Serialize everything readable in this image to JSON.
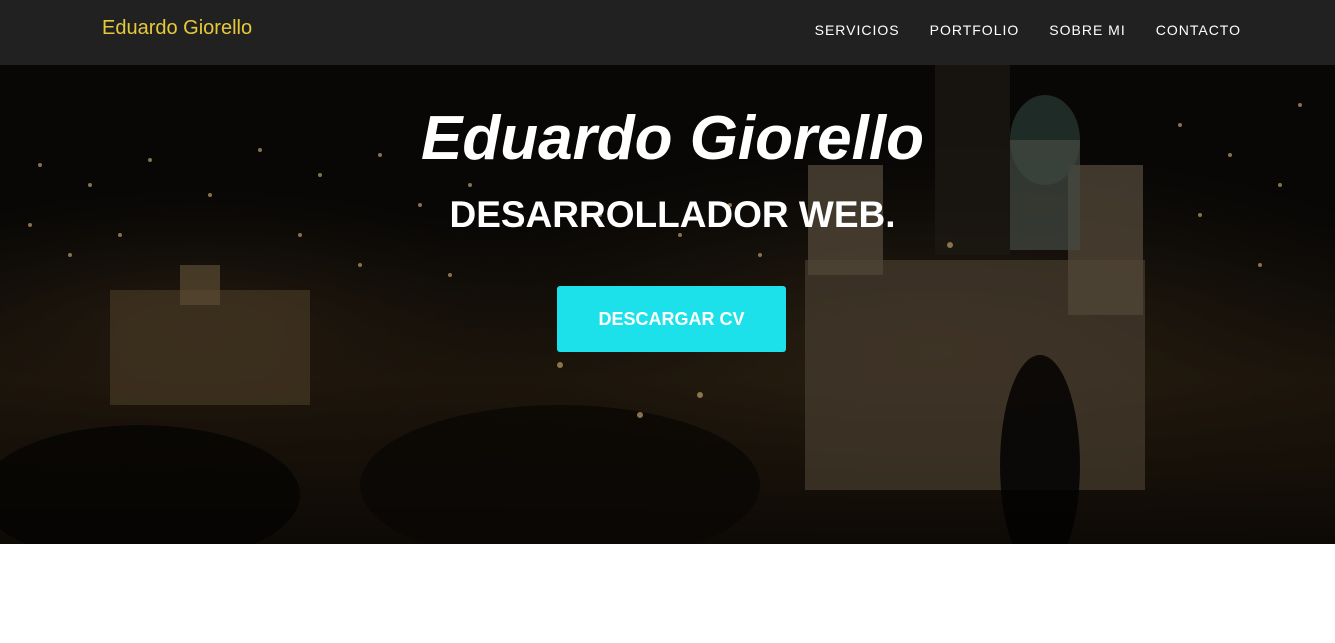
{
  "navbar": {
    "brand": "Eduardo Giorello",
    "links": [
      "SERVICIOS",
      "PORTFOLIO",
      "SOBRE MI",
      "CONTACTO"
    ]
  },
  "hero": {
    "title": "Eduardo Giorello",
    "subtitle": "DESARROLLADOR WEB.",
    "cta_label": "DESCARGAR CV",
    "background": "night-city-cathedral-photo"
  },
  "colors": {
    "navbar_bg": "#212121",
    "brand": "#e6c93a",
    "cta_bg": "#1de1ea",
    "text": "#ffffff"
  }
}
